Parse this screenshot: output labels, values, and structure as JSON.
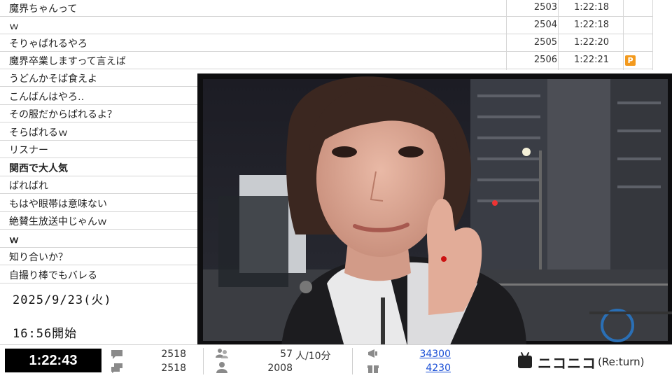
{
  "comments": [
    {
      "text": "魔界ちゃんって",
      "no": "2503",
      "time": "1:22:18",
      "mark": ""
    },
    {
      "text": "ｗ",
      "no": "2504",
      "time": "1:22:18",
      "mark": ""
    },
    {
      "text": "そりゃばれるやろ",
      "no": "2505",
      "time": "1:22:20",
      "mark": ""
    },
    {
      "text": "魔界卒業しますって言えば",
      "no": "2506",
      "time": "1:22:21",
      "mark": "P"
    },
    {
      "text": "うどんかそば食えよ",
      "no": "",
      "time": "",
      "mark": ""
    },
    {
      "text": "こんばんはやろ‥",
      "no": "",
      "time": "",
      "mark": ""
    },
    {
      "text": "その服だからばれるよ？",
      "no": "",
      "time": "",
      "mark": ""
    },
    {
      "text": "そらばれるｗ",
      "no": "",
      "time": "",
      "mark": ""
    },
    {
      "text": "リスナー",
      "no": "",
      "time": "",
      "mark": ""
    },
    {
      "text": "関西で大人気",
      "no": "",
      "time": "",
      "mark": "",
      "bold": true
    },
    {
      "text": "ばればれ",
      "no": "",
      "time": "",
      "mark": ""
    },
    {
      "text": "もはや眼帯は意味ない",
      "no": "",
      "time": "",
      "mark": ""
    },
    {
      "text": "絶賛生放送中じゃんｗ",
      "no": "",
      "time": "",
      "mark": ""
    },
    {
      "text": "ｗ",
      "no": "",
      "time": "",
      "mark": "",
      "bold": true
    },
    {
      "text": "知り合いか？",
      "no": "",
      "time": "",
      "mark": ""
    },
    {
      "text": "自撮り棒でもバレる",
      "no": "",
      "time": "",
      "mark": ""
    }
  ],
  "start_info": {
    "date": "2025/9/23(火)",
    "time": "16:56開始"
  },
  "status": {
    "elapsed": "1:22:43",
    "comments_total": "2518",
    "comments_total2": "2518",
    "active_count": "57",
    "active_unit": "人/10分",
    "visitors": "2008",
    "ad_points": "34300",
    "gift_points": "4230",
    "brand": "ニコニコ",
    "brand_sub": "(Re:turn)"
  },
  "colors": {
    "premium_mark": "#f39a1e",
    "link": "#1a4fd6",
    "elapsed_bg": "#000000"
  },
  "icons": {
    "comment": "speech-bubble-icon",
    "comments_stack": "stacked-bubbles-icon",
    "active_users": "users-icon",
    "visitor": "person-icon",
    "ad": "megaphone-icon",
    "gift": "gift-icon",
    "logo": "tv-logo-icon"
  }
}
